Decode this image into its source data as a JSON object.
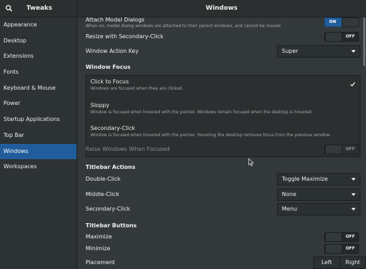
{
  "headerbar": {
    "app_title": "Tweaks",
    "window_title": "Windows",
    "search_icon": "search-icon"
  },
  "sidebar": {
    "items": [
      {
        "label": "Appearance"
      },
      {
        "label": "Desktop"
      },
      {
        "label": "Extensions"
      },
      {
        "label": "Fonts"
      },
      {
        "label": "Keyboard & Mouse"
      },
      {
        "label": "Power"
      },
      {
        "label": "Startup Applications"
      },
      {
        "label": "Top Bar"
      },
      {
        "label": "Windows",
        "active": true
      },
      {
        "label": "Workspaces"
      }
    ]
  },
  "content": {
    "attach_modal": {
      "label": "Attach Modal Dialogs",
      "description": "When on, modal dialog windows are attached to their parent windows, and cannot be moved.",
      "state": "ON"
    },
    "resize_secondary": {
      "label": "Resize with Secondary-Click",
      "state": "OFF"
    },
    "action_key": {
      "label": "Window Action Key",
      "value": "Super"
    },
    "window_focus": {
      "heading": "Window Focus",
      "options": [
        {
          "title": "Click to Focus",
          "description": "Windows are focused when they are clicked.",
          "selected": true
        },
        {
          "title": "Sloppy",
          "description": "Window is focused when hovered with the pointer. Windows remain focused when the desktop is hovered."
        },
        {
          "title": "Secondary-Click",
          "description": "Window is focused when hovered with the pointer. Hovering the desktop removes focus from the previous window."
        }
      ]
    },
    "raise_windows": {
      "label": "Raise Windows When Focused",
      "state": "OFF"
    },
    "titlebar_actions": {
      "heading": "Titlebar Actions",
      "double_click": {
        "label": "Double-Click",
        "value": "Toggle Maximize"
      },
      "middle_click": {
        "label": "Middle-Click",
        "value": "None"
      },
      "secondary_click": {
        "label": "Secondary-Click",
        "value": "Menu"
      }
    },
    "titlebar_buttons": {
      "heading": "Titlebar Buttons",
      "maximize": {
        "label": "Maximize",
        "state": "OFF"
      },
      "minimize": {
        "label": "Minimize",
        "state": "OFF"
      },
      "placement": {
        "label": "Placement",
        "left": "Left",
        "right": "Right"
      }
    }
  },
  "colors": {
    "accent": "#215d9c",
    "background": "#33393b",
    "sidebar": "#2d3234"
  }
}
